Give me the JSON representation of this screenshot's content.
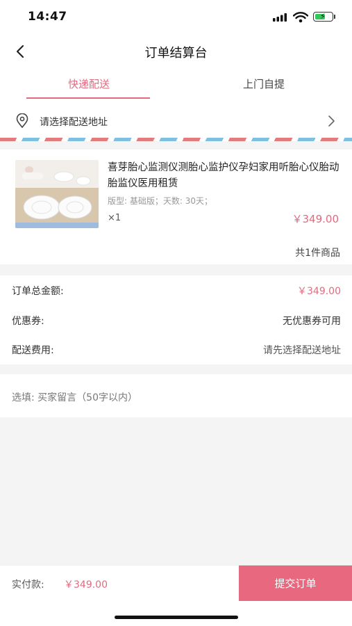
{
  "status_bar": {
    "time": "14:47"
  },
  "header": {
    "title": "订单结算台"
  },
  "tabs": [
    {
      "label": "快递配送",
      "active": true
    },
    {
      "label": "上门自提",
      "active": false
    }
  ],
  "address": {
    "placeholder": "请选择配送地址"
  },
  "product": {
    "name": "喜芽胎心监测仪测胎心监护仪孕妇家用听胎心仪胎动胎监仪医用租赁",
    "spec": "版型: 基础版；天数: 30天；",
    "quantity": "×1",
    "price": "￥349.00",
    "count_text": "共1件商品"
  },
  "summary": {
    "total_label": "订单总金额:",
    "total_value": "￥349.00",
    "coupon_label": "优惠券:",
    "coupon_value": "无优惠券可用",
    "shipping_label": "配送费用:",
    "shipping_value": "请先选择配送地址"
  },
  "note": {
    "placeholder": "选填: 买家留言（50字以内）"
  },
  "footer": {
    "pay_label": "实付款:",
    "pay_value": "￥349.00",
    "submit_label": "提交订单"
  },
  "colors": {
    "accent": "#e06b80",
    "button": "#e8687f",
    "background": "#f4f4f4"
  }
}
